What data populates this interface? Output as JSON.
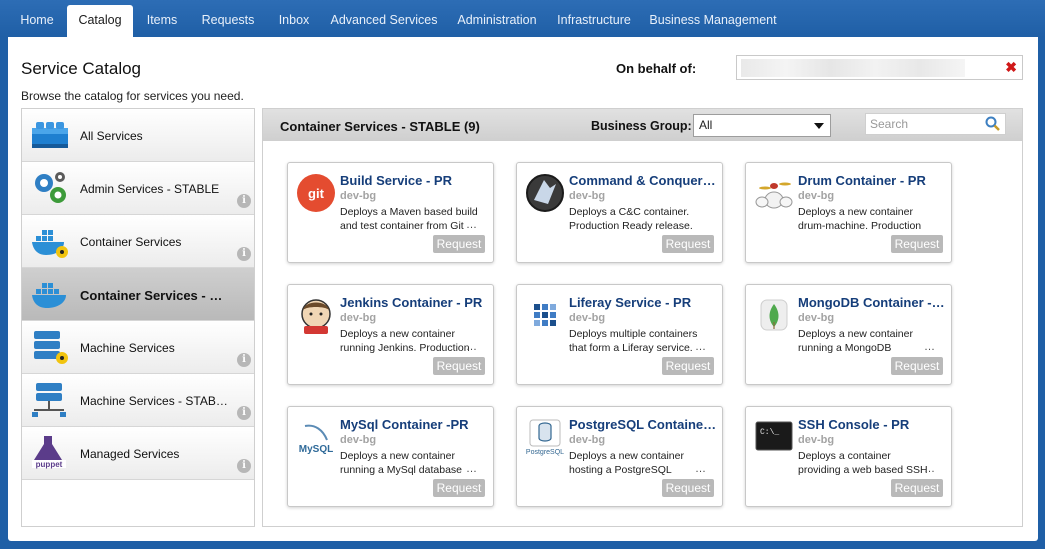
{
  "nav": {
    "tabs": [
      {
        "label": "Home"
      },
      {
        "label": "Catalog"
      },
      {
        "label": "Items"
      },
      {
        "label": "Requests"
      },
      {
        "label": "Inbox"
      },
      {
        "label": "Advanced Services"
      },
      {
        "label": "Administration"
      },
      {
        "label": "Infrastructure"
      },
      {
        "label": "Business Management"
      }
    ],
    "active_tab": "Catalog"
  },
  "page": {
    "title": "Service Catalog",
    "subtitle": "Browse the catalog for services you need.",
    "behalf_label": "On behalf of:",
    "behalf_value": "",
    "clear_icon": "close-icon"
  },
  "sidebar": {
    "items": [
      {
        "label": "All Services",
        "icon": "blocks-icon"
      },
      {
        "label": "Admin Services - STABLE",
        "icon": "gears-icon"
      },
      {
        "label": "Container Services",
        "icon": "docker-icon"
      },
      {
        "label": "Container Services - STABLE",
        "icon": "docker-icon"
      },
      {
        "label": "Machine Services",
        "icon": "server-icon"
      },
      {
        "label": "Machine Services - STABLE",
        "icon": "server-network-icon"
      },
      {
        "label": "Managed Services",
        "icon": "puppet-icon"
      }
    ],
    "selected_index": 3,
    "info_glyph": "i"
  },
  "content": {
    "title": "Container Services - STABLE (9)",
    "business_group_label": "Business Group:",
    "business_group_value": "All",
    "search_placeholder": "Search"
  },
  "cards": [
    {
      "title": "Build Service - PR",
      "subtitle": "dev-bg",
      "desc": "Deploys a Maven based build and test container from Git",
      "icon": "git-icon",
      "button": "Request"
    },
    {
      "title": "Command & Conquer Container - PR",
      "subtitle": "dev-bg",
      "desc": "Deploys a C&C container. Production Ready release.",
      "icon": "command-conquer-icon",
      "button": "Request"
    },
    {
      "title": "Drum Container - PR",
      "subtitle": "dev-bg",
      "desc": "Deploys a new container drum-machine. Production ready",
      "icon": "drum-icon",
      "button": "Request"
    },
    {
      "title": "Jenkins Container - PR",
      "subtitle": "dev-bg",
      "desc": "Deploys a new container running Jenkins. Production ready",
      "icon": "jenkins-icon",
      "button": "Request"
    },
    {
      "title": "Liferay Service - PR",
      "subtitle": "dev-bg",
      "desc": "Deploys multiple containers that form a Liferay service.",
      "icon": "liferay-icon",
      "button": "Request"
    },
    {
      "title": "MongoDB Container - PR",
      "subtitle": "dev-bg",
      "desc": "Deploys a new container running a MongoDB database",
      "icon": "mongodb-icon",
      "button": "Request"
    },
    {
      "title": "MySql Container -PR",
      "subtitle": "dev-bg",
      "desc": "Deploys a new container running a MySql database",
      "icon": "mysql-icon",
      "button": "Request"
    },
    {
      "title": "PostgreSQL Container - PR",
      "subtitle": "dev-bg",
      "desc": "Deploys a new container hosting a PostgreSQL",
      "icon": "postgresql-icon",
      "button": "Request"
    },
    {
      "title": "SSH Console - PR",
      "subtitle": "dev-bg",
      "desc": "Deploys a container providing a web based SSH console to",
      "icon": "terminal-icon",
      "button": "Request"
    }
  ],
  "colors": {
    "nav_bg": "#1f5fa6",
    "link": "#163e7a",
    "button": "#b9b9b9",
    "clear": "#d01818"
  }
}
